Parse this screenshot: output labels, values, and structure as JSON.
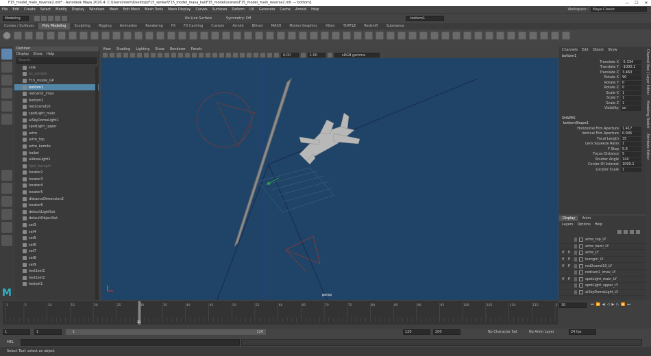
{
  "window": {
    "title": "F15_model_main_reverse2.mb* - Autodesk Maya 2020.4: C:\\Users\\ment\\Desktop\\F15_senkei\\F15_model_maya_kai\\F15_model\\scenes\\F15_model_main_reverse2.mb  ---  bottom1",
    "min_glyph": "—",
    "max_glyph": "☐",
    "close_glyph": "✕"
  },
  "menubar": [
    "File",
    "Edit",
    "Create",
    "Select",
    "Modify",
    "Display",
    "Windows",
    "Mesh",
    "Edit Mesh",
    "Mesh Tools",
    "Mesh Display",
    "Curves",
    "Surfaces",
    "Deform",
    "UV",
    "Generate",
    "Cache",
    "Arnold",
    "Help"
  ],
  "workspace": {
    "label": "Workspace :",
    "value": "Maya Classic"
  },
  "statusline": {
    "mode": "Modeling",
    "symmetry": "Symmetry: Off",
    "live": "No Live Surface",
    "camera": "bottom1"
  },
  "shelf_tabs": [
    "Curves / Surfaces",
    "Poly Modeling",
    "Sculpting",
    "Rigging",
    "Animation",
    "Rendering",
    "FX",
    "FX Caching",
    "Custom",
    "Arnold",
    "Bifrost",
    "MASH",
    "Motion Graphics",
    "XGen",
    "TURTLE",
    "Redshift",
    "Substance"
  ],
  "shelf_active": "Poly Modeling",
  "outliner": {
    "title": "Outliner",
    "menu": [
      "Display",
      "Show",
      "Help"
    ],
    "search_placeholder": "Search...",
    "items": [
      {
        "label": "side",
        "state": ""
      },
      {
        "label": "ax_sample",
        "state": "dim"
      },
      {
        "label": "F15_model_GP",
        "state": ""
      },
      {
        "label": "bottom1",
        "state": "sel"
      },
      {
        "label": "redcam1_imax",
        "state": ""
      },
      {
        "label": "bottom2",
        "state": ""
      },
      {
        "label": "red2camd10",
        "state": ""
      },
      {
        "label": "spotLight_main",
        "state": ""
      },
      {
        "label": "aiSkyDomeLight1",
        "state": ""
      },
      {
        "label": "spotLight_upper",
        "state": ""
      },
      {
        "label": "artre",
        "state": ""
      },
      {
        "label": "artre_top",
        "state": ""
      },
      {
        "label": "artre_kamite",
        "state": ""
      },
      {
        "label": "haikei",
        "state": ""
      },
      {
        "label": "aiAreaLight1",
        "state": ""
      },
      {
        "label": "light_kurogiri",
        "state": "dim"
      },
      {
        "label": "locator2",
        "state": ""
      },
      {
        "label": "locator3",
        "state": ""
      },
      {
        "label": "locator4",
        "state": ""
      },
      {
        "label": "locator5",
        "state": ""
      },
      {
        "label": "distanceDimension2",
        "state": ""
      },
      {
        "label": "locator6",
        "state": ""
      },
      {
        "label": "defaultLightSet",
        "state": ""
      },
      {
        "label": "defaultObjectSet",
        "state": ""
      },
      {
        "label": "set3",
        "state": ""
      },
      {
        "label": "set4",
        "state": ""
      },
      {
        "label": "set5",
        "state": ""
      },
      {
        "label": "set6",
        "state": ""
      },
      {
        "label": "set7",
        "state": ""
      },
      {
        "label": "set8",
        "state": ""
      },
      {
        "label": "set9",
        "state": ""
      },
      {
        "label": "test1set1",
        "state": ""
      },
      {
        "label": "test1set2",
        "state": ""
      },
      {
        "label": "testset1",
        "state": ""
      }
    ]
  },
  "viewport": {
    "menu": [
      "View",
      "Shading",
      "Lighting",
      "Show",
      "Renderer",
      "Panels"
    ],
    "field1": "0.00",
    "field2": "1.00",
    "colorspace": "sRGB gamma",
    "camera_label": "persp"
  },
  "channelbox": {
    "menu": [
      "Channels",
      "Edit",
      "Object",
      "Show"
    ],
    "object": "bottom1",
    "attrs": [
      {
        "name": "Translate X",
        "value": "-5.334"
      },
      {
        "name": "Translate Y",
        "value": "-1000.1"
      },
      {
        "name": "Translate Z",
        "value": "3.460"
      },
      {
        "name": "Rotate X",
        "value": "90"
      },
      {
        "name": "Rotate Y",
        "value": "0"
      },
      {
        "name": "Rotate Z",
        "value": "0"
      },
      {
        "name": "Scale X",
        "value": "1"
      },
      {
        "name": "Scale Y",
        "value": "1"
      },
      {
        "name": "Scale Z",
        "value": "1"
      },
      {
        "name": "Visibility",
        "value": "on"
      }
    ],
    "shapes_title": "SHAPES",
    "shape": "bottomShape1",
    "shape_attrs": [
      {
        "name": "Horizontal Film Aperture",
        "value": "1.417"
      },
      {
        "name": "Vertical Film Aperture",
        "value": "0.945"
      },
      {
        "name": "Focal Length",
        "value": "35"
      },
      {
        "name": "Lens Squeeze Ratio",
        "value": "1"
      },
      {
        "name": "F Stop",
        "value": "5.6"
      },
      {
        "name": "Focus Distance",
        "value": "5"
      },
      {
        "name": "Shutter Angle",
        "value": "144"
      },
      {
        "name": "Center Of Interest",
        "value": "1000.1"
      },
      {
        "name": "Locator Scale",
        "value": "1"
      }
    ]
  },
  "side_tabs": [
    "Channel Box / Layer Editor",
    "Modeling Toolkit",
    "Attribute Editor"
  ],
  "layers": {
    "tabs": [
      "Display",
      "Anim"
    ],
    "menu": [
      "Layers",
      "Options",
      "Help"
    ],
    "items": [
      {
        "v": "",
        "p": "",
        "label": "artre_top_LY"
      },
      {
        "v": "",
        "p": "",
        "label": "artre_kami_LY"
      },
      {
        "v": "V",
        "p": "P",
        "label": "artre_LY"
      },
      {
        "v": "V",
        "p": "P",
        "label": "kurogiri_LY"
      },
      {
        "v": "V",
        "p": "P",
        "label": "red2camd10_LY"
      },
      {
        "v": "",
        "p": "",
        "label": "redcam1_imax_LY"
      },
      {
        "v": "V",
        "p": "P",
        "label": "spotLight_main_LY"
      },
      {
        "v": "",
        "p": "",
        "label": "spotLight_upper_LY"
      },
      {
        "v": "",
        "p": "",
        "label": "aiSkyDomeLight_LY"
      }
    ]
  },
  "timeline": {
    "ticks": [
      "1",
      "5",
      "10",
      "15",
      "20",
      "25",
      "30",
      "35",
      "40",
      "45",
      "50",
      "55",
      "60",
      "65",
      "70",
      "75",
      "80",
      "85",
      "90",
      "95",
      "100",
      "105",
      "110",
      "115",
      "120"
    ],
    "current_frame": "30",
    "current_field": "30"
  },
  "range": {
    "start": "1",
    "start2": "1",
    "inner_start": "1",
    "inner_end": "120",
    "end": "120",
    "end2": "200",
    "character": "No Character Set",
    "anim_layer": "No Anim Layer",
    "fps": "24 fps"
  },
  "cmdline": {
    "label": "MEL"
  },
  "helpline": {
    "text": "Select Tool: select an object"
  }
}
